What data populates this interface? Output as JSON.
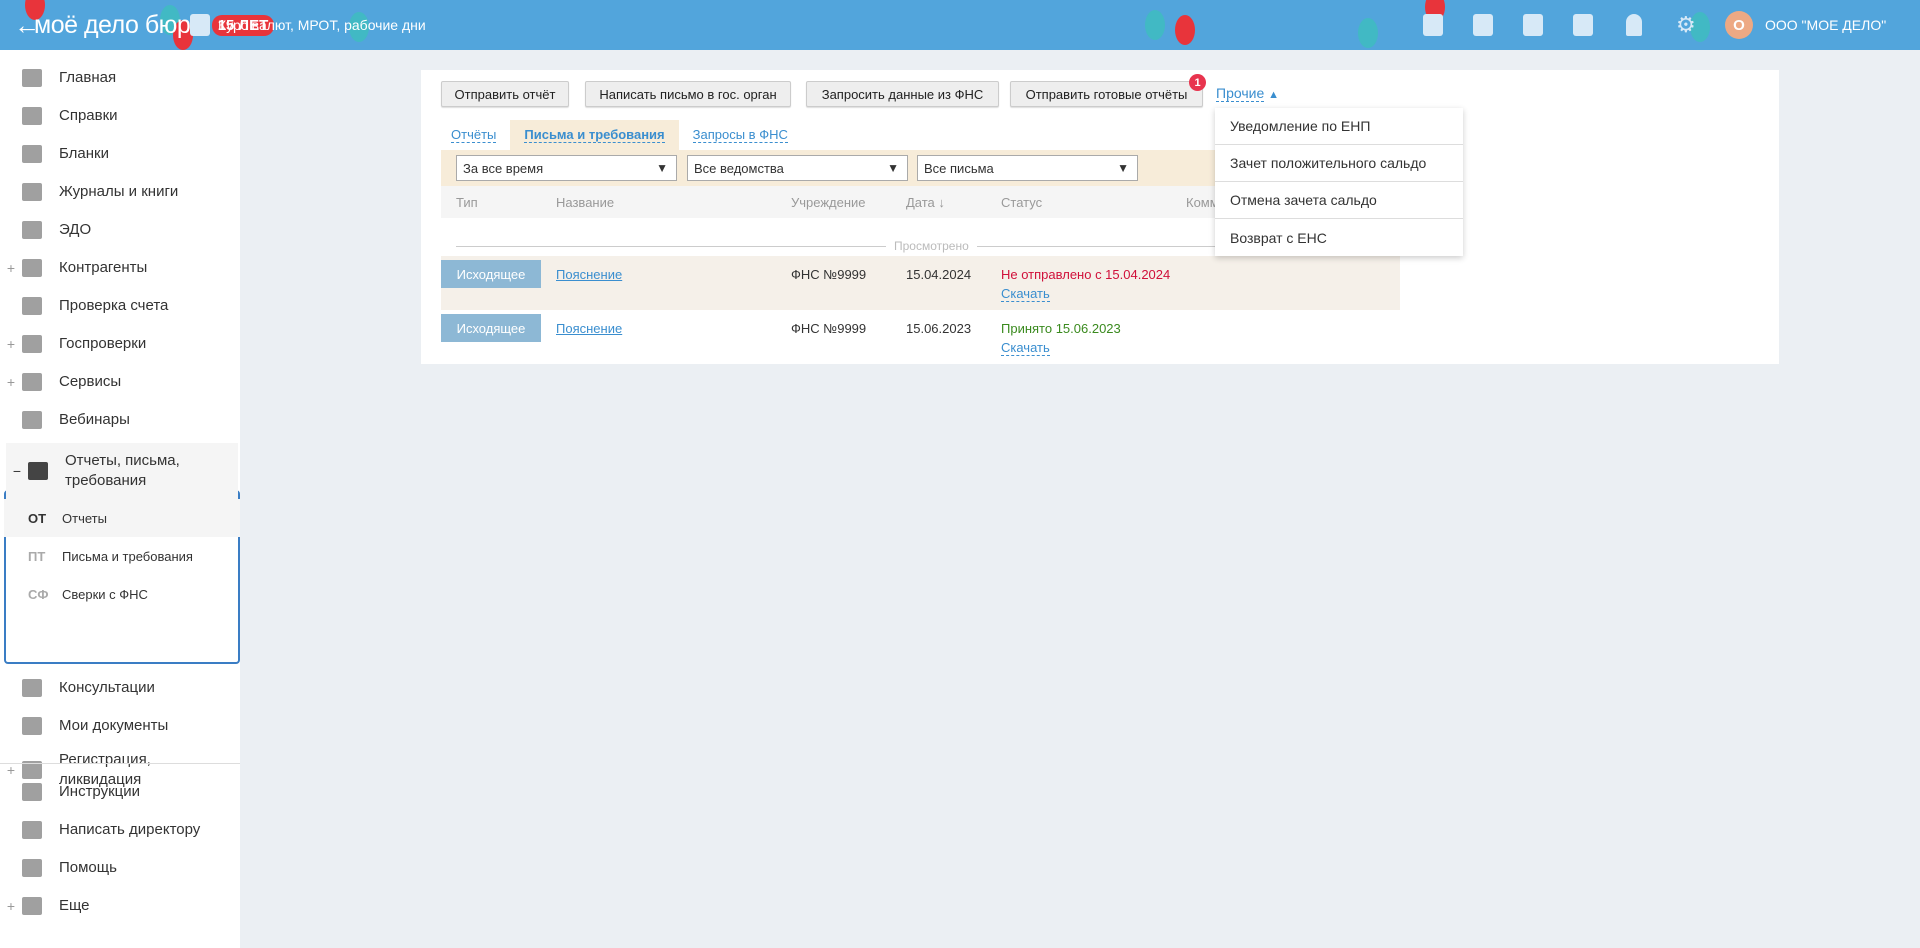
{
  "header": {
    "logo": "моё дело бюро",
    "anniversary": "15 ЛЕТ",
    "info_link": "Курс валют, МРОТ, рабочие дни",
    "avatar_letter": "О",
    "company": "ООО \"МОЕ ДЕЛО\""
  },
  "sidebar": {
    "items": [
      {
        "label": "Главная",
        "plus": ""
      },
      {
        "label": "Справки",
        "plus": ""
      },
      {
        "label": "Бланки",
        "plus": ""
      },
      {
        "label": "Журналы и книги",
        "plus": ""
      },
      {
        "label": "ЭДО",
        "plus": ""
      },
      {
        "label": "Контрагенты",
        "plus": "+"
      },
      {
        "label": "Проверка счета",
        "plus": ""
      },
      {
        "label": "Госпроверки",
        "plus": "+"
      },
      {
        "label": "Сервисы",
        "plus": "+"
      },
      {
        "label": "Вебинары",
        "plus": ""
      }
    ],
    "group": {
      "label": "Отчеты, письма, требования",
      "toggle": "−",
      "subs": [
        {
          "abbr": "ОТ",
          "label": "Отчеты"
        },
        {
          "abbr": "ПТ",
          "label": "Письма и требования"
        },
        {
          "abbr": "СФ",
          "label": "Сверки с ФНС"
        }
      ]
    },
    "items2": [
      {
        "label": "Консультации",
        "plus": ""
      },
      {
        "label": "Мои документы",
        "plus": ""
      },
      {
        "label": "Регистрация, ликвидация",
        "plus": "+"
      }
    ],
    "bottom": [
      {
        "label": "Инструкции",
        "plus": ""
      },
      {
        "label": "Написать директору",
        "plus": ""
      },
      {
        "label": "Помощь",
        "plus": ""
      },
      {
        "label": "Еще",
        "plus": "+"
      }
    ]
  },
  "toolbar": {
    "send_report": "Отправить отчёт",
    "write_letter": "Написать письмо в гос. орган",
    "request_fns": "Запросить данные из ФНС",
    "send_ready": "Отправить готовые отчёты",
    "send_ready_count": "1",
    "other": "Прочие"
  },
  "menu": [
    "Уведомление по ЕНП",
    "Зачет положительного сальдо",
    "Отмена зачета сальдо",
    "Возврат с ЕНС"
  ],
  "tabs": [
    "Отчёты",
    "Письма и требования",
    "Запросы в ФНС"
  ],
  "filters": [
    "За все время",
    "Все ведомства",
    "Все письма"
  ],
  "columns": [
    "Тип",
    "Название",
    "Учреждение",
    "Дата ↓",
    "Статус",
    "Комм"
  ],
  "separator": "Просмотрено",
  "rows": [
    {
      "type": "Исходящее",
      "name": "Пояснение",
      "org": "ФНС №9999",
      "date": "15.04.2024",
      "status": "Не отправлено с 15.04.2024",
      "download": "Скачать"
    },
    {
      "type": "Исходящее",
      "name": "Пояснение",
      "org": "ФНС №9999",
      "date": "15.06.2023",
      "status": "Принято 15.06.2023",
      "download": "Скачать"
    }
  ],
  "colors": {
    "header": "#52a5dc",
    "error": "#d0103a",
    "success": "#3a8a1e",
    "link": "#3a8ecf"
  }
}
